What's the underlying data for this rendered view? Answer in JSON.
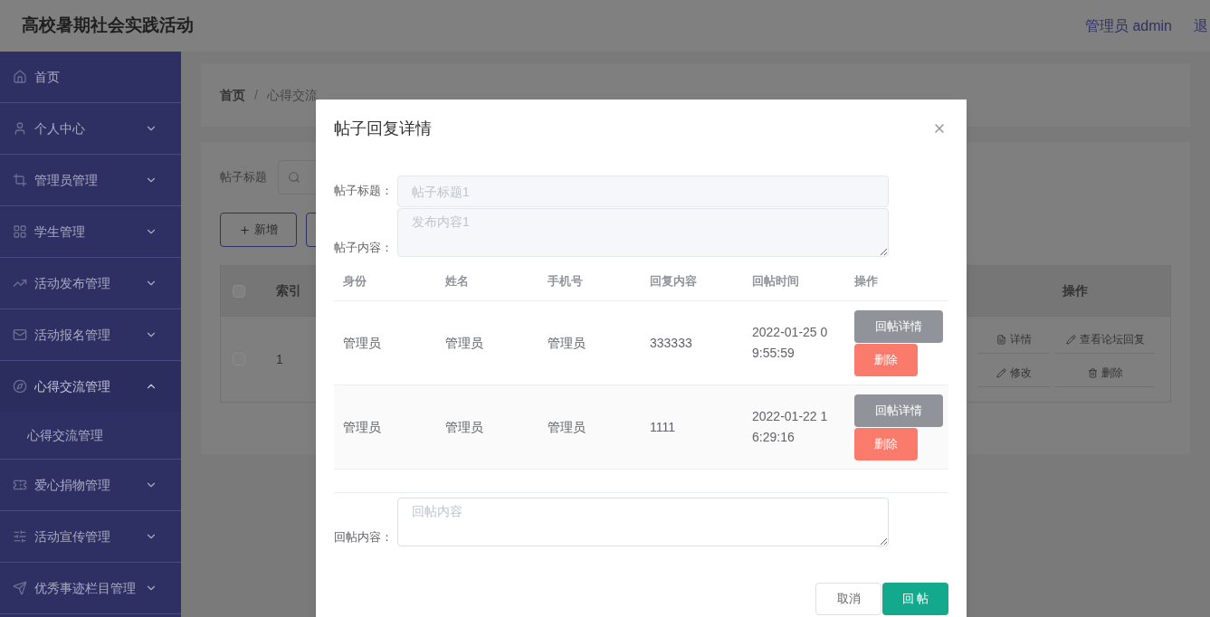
{
  "app_title": "高校暑期社会实践活动",
  "user": "管理员 admin",
  "logout": "退",
  "sidebar": [
    {
      "label": "首页",
      "kind": "link"
    },
    {
      "label": "个人中心",
      "kind": "menu",
      "expanded": false
    },
    {
      "label": "管理员管理",
      "kind": "menu",
      "expanded": false
    },
    {
      "label": "学生管理",
      "kind": "menu",
      "expanded": false
    },
    {
      "label": "活动发布管理",
      "kind": "menu",
      "expanded": false
    },
    {
      "label": "活动报名管理",
      "kind": "menu",
      "expanded": false
    },
    {
      "label": "心得交流管理",
      "kind": "menu",
      "expanded": true,
      "children": [
        {
          "label": "心得交流管理"
        }
      ]
    },
    {
      "label": "爱心捐物管理",
      "kind": "menu",
      "expanded": false
    },
    {
      "label": "活动宣传管理",
      "kind": "menu",
      "expanded": false
    },
    {
      "label": "优秀事迹栏目管理",
      "kind": "menu",
      "expanded": false
    }
  ],
  "breadcrumb": [
    "首页",
    "心得交流"
  ],
  "breadcrumb_separator": "/",
  "filter": {
    "label": "帖子标题"
  },
  "add_button": "新增",
  "table": {
    "all_checked": false,
    "columns": [
      "索引",
      "操作"
    ],
    "rows": [
      {
        "checked": false,
        "index": "1",
        "actions": [
          "详情",
          "查看论坛回复",
          "修改",
          "删除"
        ]
      }
    ]
  },
  "dialog": {
    "title": "帖子回复详情",
    "fields": [
      {
        "label": "帖子标题：",
        "kind": "input",
        "placeholder": "帖子标题1"
      },
      {
        "label": "帖子内容：",
        "kind": "textarea",
        "placeholder": "发布内容1"
      }
    ],
    "columns": [
      "身份",
      "姓名",
      "手机号",
      "回复内容",
      "回帖时间",
      "操作"
    ],
    "rows": [
      {
        "cells": [
          "管理员",
          "管理员",
          "管理员",
          "333333",
          "2022-01-25 09:55:59"
        ],
        "actions": [
          "回帖详情",
          "删除"
        ]
      },
      {
        "cells": [
          "管理员",
          "管理员",
          "管理员",
          "1111",
          "2022-01-22 16:29:16"
        ],
        "actions": [
          "回帖详情",
          "删除"
        ]
      }
    ],
    "reply": {
      "label": "回帖内容：",
      "placeholder": "回帖内容"
    },
    "buttons": [
      {
        "label": "取消",
        "kind": "secondary"
      },
      {
        "label": "回 帖",
        "kind": "primary"
      }
    ]
  }
}
